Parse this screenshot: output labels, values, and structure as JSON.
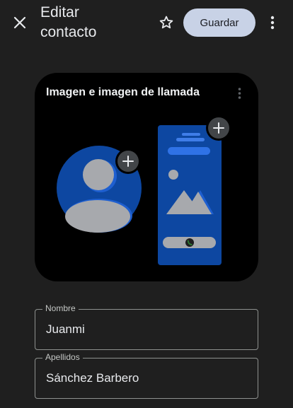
{
  "header": {
    "title_line1": "Editar",
    "title_line2": "contacto",
    "save_label": "Guardar",
    "close_icon": "close-icon",
    "star_icon": "star-outline-icon",
    "more_icon": "more-vertical-icon"
  },
  "photo_card": {
    "title": "Imagen e imagen de llamada",
    "more_icon": "more-vertical-icon",
    "add_icon": "plus-icon"
  },
  "fields": [
    {
      "label": "Nombre",
      "value": "Juanmi"
    },
    {
      "label": "Apellidos",
      "value": "Sánchez Barbero"
    }
  ],
  "colors": {
    "background": "#1f1f1f",
    "card": "#000000",
    "accent_blue": "#0d47a1",
    "save_button": "#c8d2e6"
  }
}
